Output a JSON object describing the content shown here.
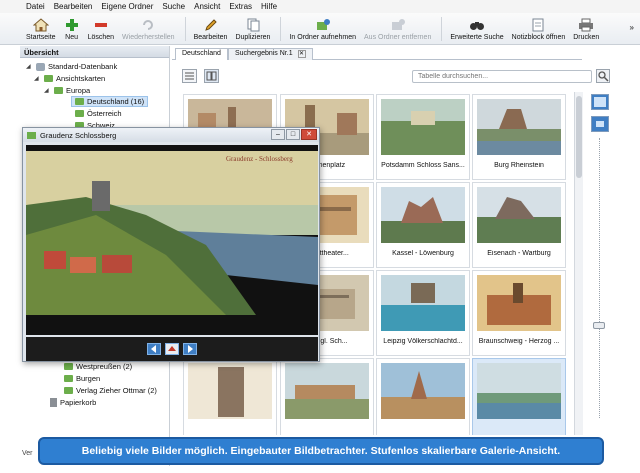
{
  "menu": [
    "Datei",
    "Bearbeiten",
    "Eigene Ordner",
    "Suche",
    "Ansicht",
    "Extras",
    "Hilfe"
  ],
  "toolbar": {
    "items": [
      {
        "label": "Startseite",
        "icon": "home-icon"
      },
      {
        "label": "Neu",
        "icon": "plus-icon"
      },
      {
        "label": "Löschen",
        "icon": "minus-icon"
      },
      {
        "label": "Wiederherstellen",
        "icon": "restore-icon"
      },
      {
        "label": "Bearbeiten",
        "icon": "pencil-icon"
      },
      {
        "label": "Duplizieren",
        "icon": "duplicate-icon"
      },
      {
        "label": "In Ordner aufnehmen",
        "icon": "folder-add-icon"
      },
      {
        "label": "Aus Ordner entfernen",
        "icon": "folder-remove-icon"
      },
      {
        "label": "Erweiterte Suche",
        "icon": "binoculars-icon"
      },
      {
        "label": "Notizblock öffnen",
        "icon": "notepad-icon"
      },
      {
        "label": "Drucken",
        "icon": "printer-icon"
      }
    ],
    "more": "»"
  },
  "tree": {
    "header": "Übersicht",
    "root": "Standard-Datenbank",
    "ansichtskarten": "Ansichtskarten",
    "europa": "Europa",
    "deutschland": "Deutschland (16)",
    "oesterreich": "Österreich",
    "schweiz": "Schweiz",
    "westpreussen": "Westpreußen (2)",
    "burgen": "Burgen",
    "verlag": "Verlag Zieher Ottmar (2)",
    "papierkorb": "Papierkorb"
  },
  "tabs": {
    "active": "Deutschland",
    "second": "Suchergebnis Nr.1"
  },
  "search": {
    "placeholder": "Tabelle durchsuchen..."
  },
  "cards": [
    {
      "caption": "",
      "thumb": "town"
    },
    {
      "caption": "Marienplatz",
      "thumb": "town"
    },
    {
      "caption": "Potsdamm Schloss Sans...",
      "thumb": "park"
    },
    {
      "caption": "Burg Rheinstein",
      "thumb": "castle"
    },
    {
      "caption": "Stadttheater...",
      "thumb": "theater"
    },
    {
      "caption": "Kassel - Löwenburg",
      "thumb": "castle"
    },
    {
      "caption": "Eisenach - Wartburg",
      "thumb": "castle"
    },
    {
      "caption": "Königl. Sch...",
      "thumb": "town"
    },
    {
      "caption": "Leipzig Völkerschlachtd...",
      "thumb": "monument"
    },
    {
      "caption": "Braunschweig - Herzog ...",
      "thumb": "monument"
    },
    {
      "caption": "",
      "thumb": "tower"
    },
    {
      "caption": "",
      "thumb": "town"
    },
    {
      "caption": "",
      "thumb": "church"
    },
    {
      "caption": "",
      "thumb": "river"
    }
  ],
  "viewer": {
    "title": "Graudenz Schlossberg",
    "image_caption": "Graudenz - Schlossberg"
  },
  "banner": "Beliebig viele Bilder möglich. Eingebauter Bildbetrachter. Stufenlos skalierbare Galerie-Ansicht.",
  "status": "Ver",
  "colors": {
    "accent": "#2f7fd1",
    "selection": "#cfe3f8"
  }
}
